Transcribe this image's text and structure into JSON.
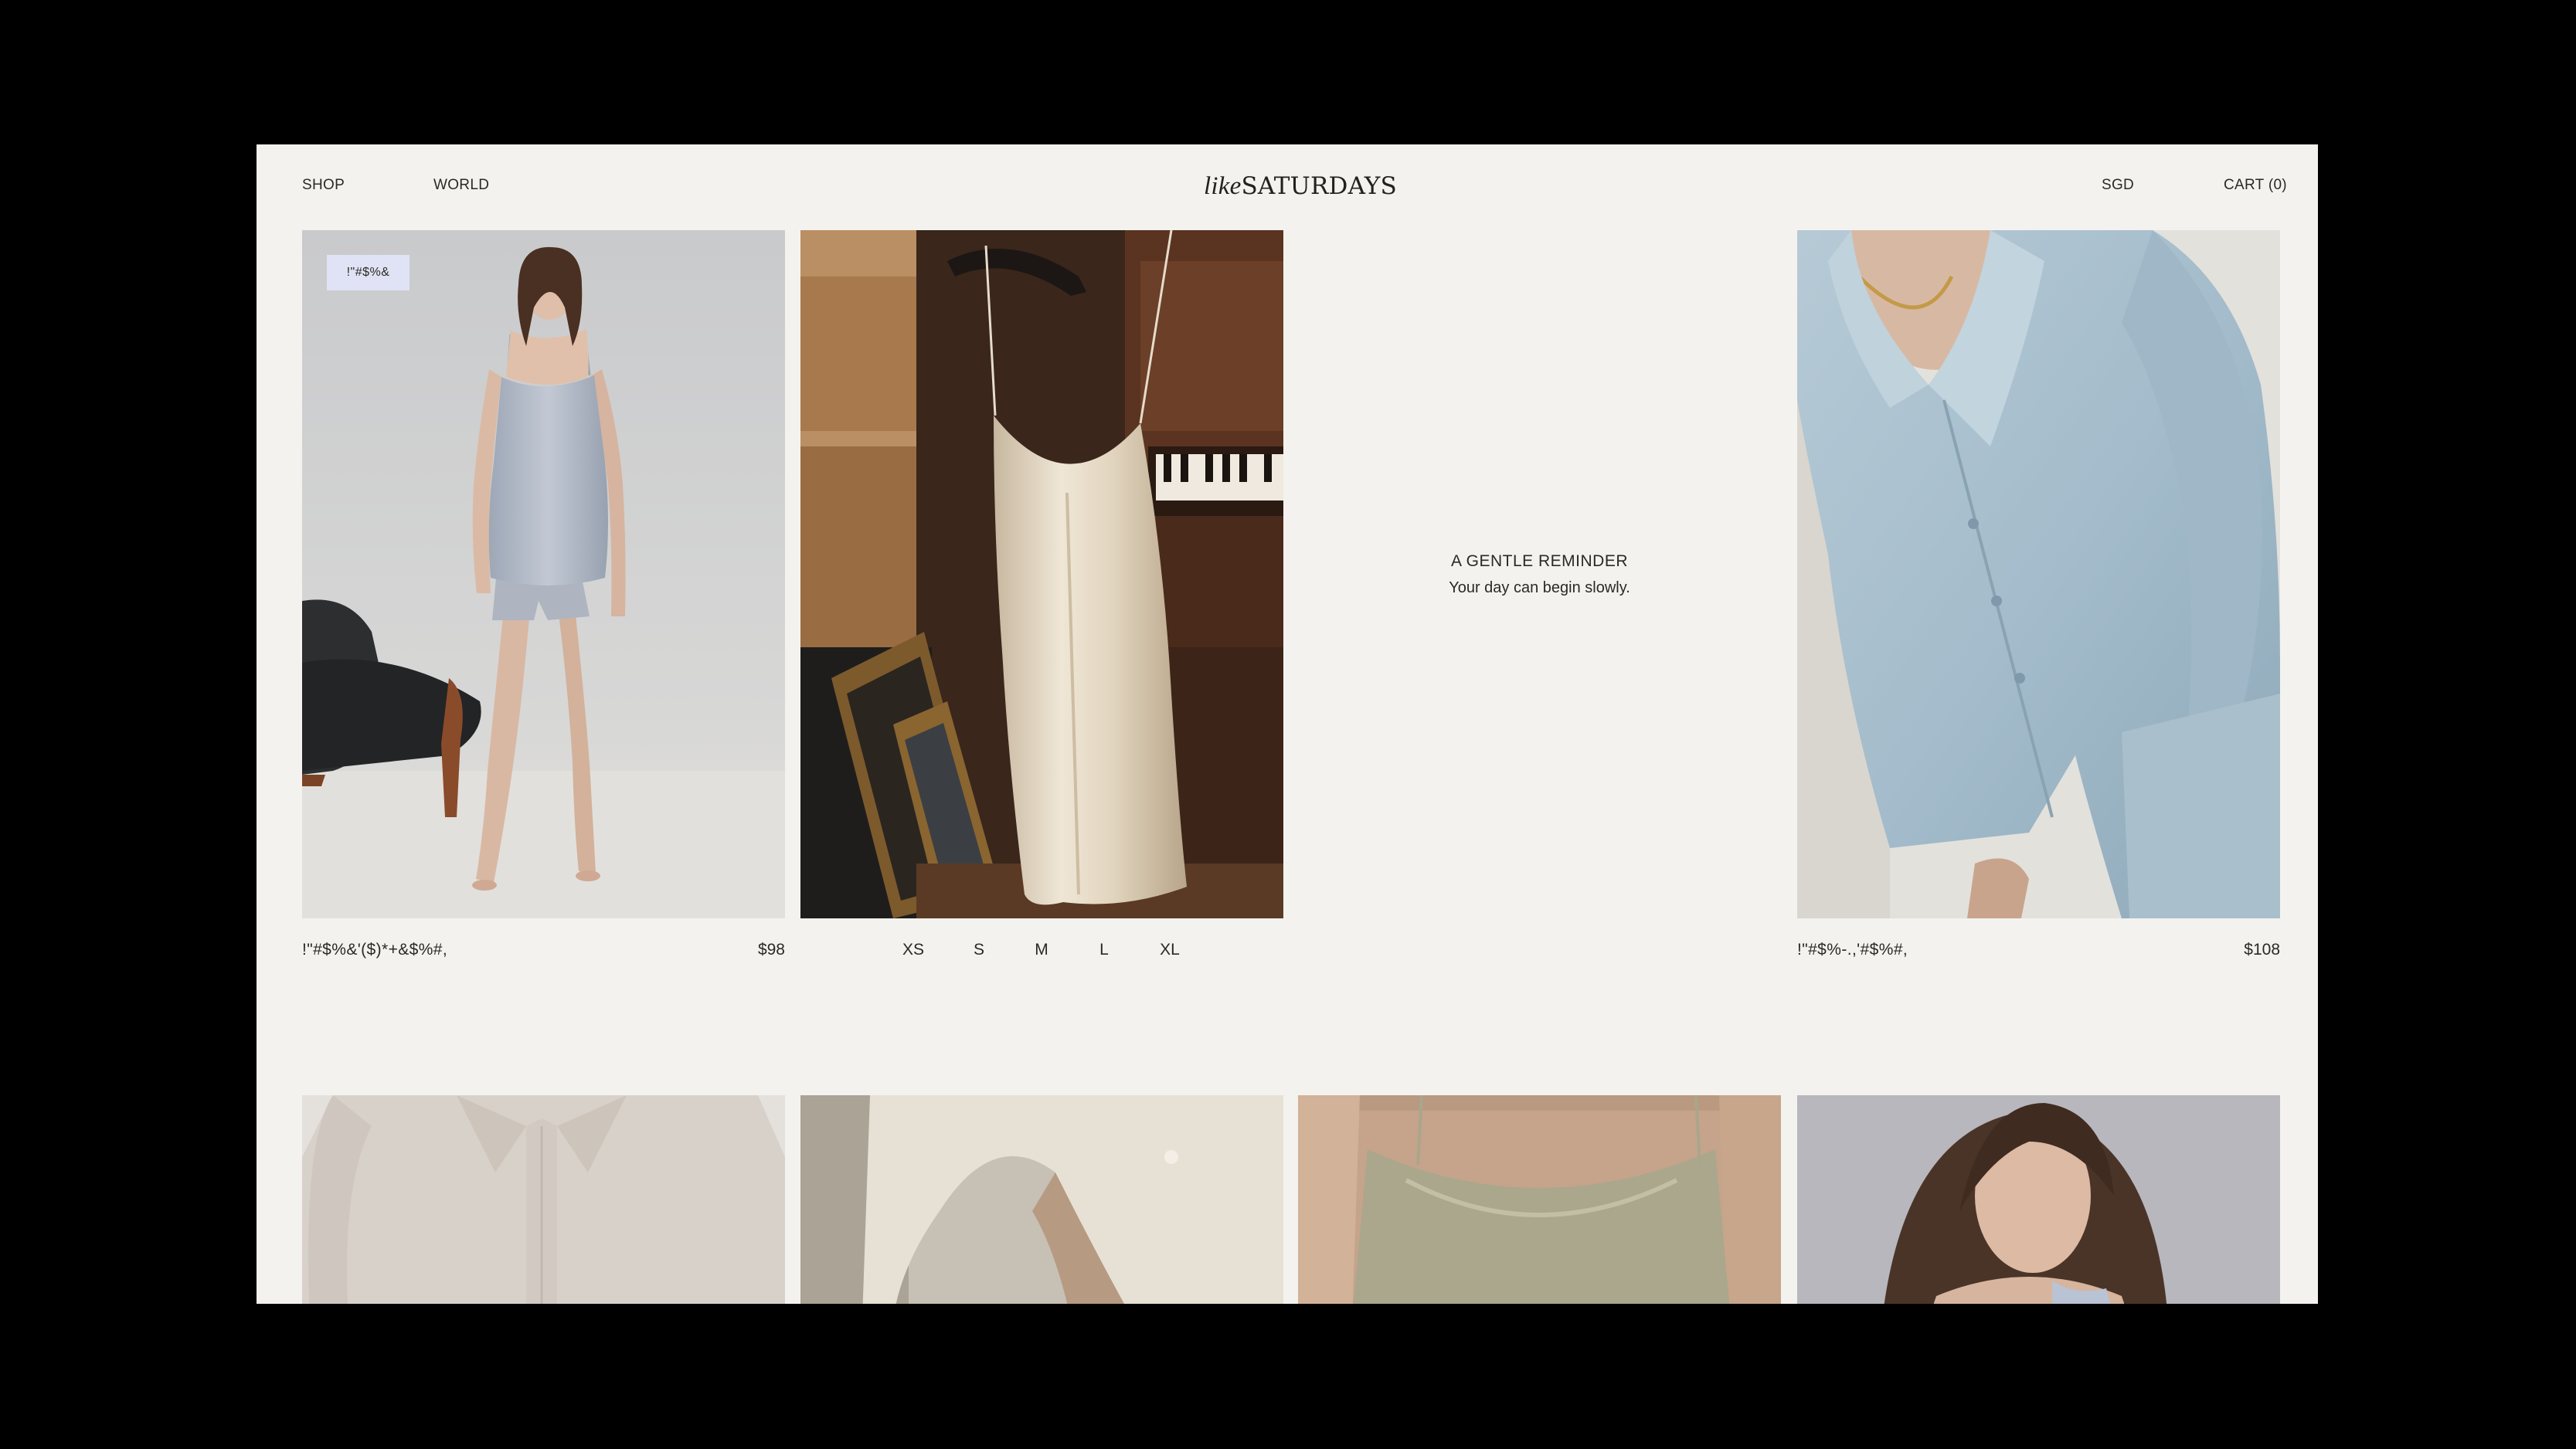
{
  "header": {
    "nav_left": [
      "SHOP",
      "WORLD"
    ],
    "logo_italic": "like",
    "logo_main": "SATURDAYS",
    "currency": "SGD",
    "cart": "CART (0)"
  },
  "products": [
    {
      "badge": "!\"#$%&",
      "name": "!\"#$%&'($)*+&$%#,",
      "price": "$98"
    },
    {
      "sizes": [
        "XS",
        "S",
        "M",
        "L",
        "XL"
      ]
    },
    {
      "name": "!\"#$%-.,'#$%#,",
      "price": "$108"
    }
  ],
  "reminder": {
    "title": "A GENTLE REMINDER",
    "subtitle": "Your day can begin slowly."
  },
  "colors": {
    "frame": "#000000",
    "page": "#f4f2ef",
    "text": "#2b2925",
    "badge": "#dfe3f5"
  }
}
